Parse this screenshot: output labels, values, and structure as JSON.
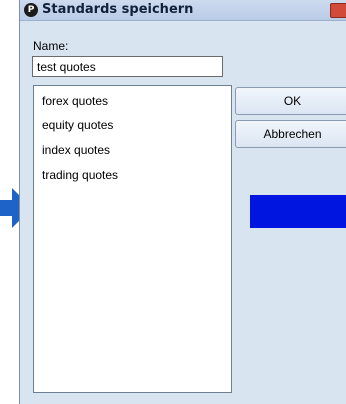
{
  "dialog": {
    "title": "Standards speichern",
    "icon_glyph": "P",
    "name_label": "Name:",
    "name_value": "test quotes",
    "list_items": [
      "forex quotes",
      "equity quotes",
      "index quotes",
      "trading quotes"
    ],
    "ok_label": "OK",
    "cancel_label": "Abbrechen"
  },
  "annotations": {
    "left_arrow_color": "#1e63c8",
    "blue_block_color": "#0016e0"
  }
}
